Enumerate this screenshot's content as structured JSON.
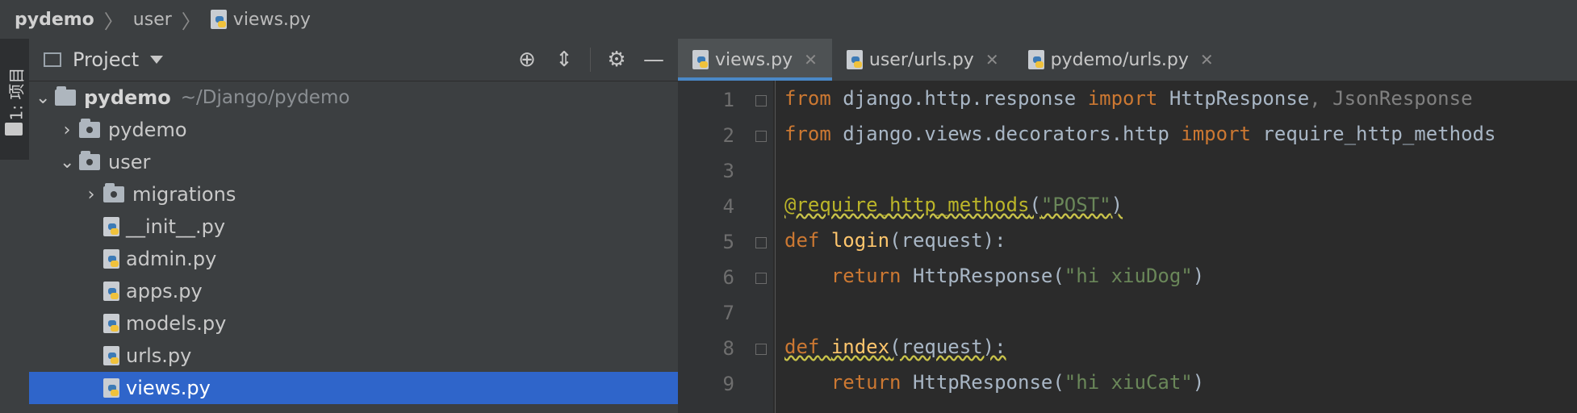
{
  "breadcrumb": {
    "items": [
      "pydemo",
      "user",
      "views.py"
    ],
    "separator": "〉"
  },
  "tool_window_strip": {
    "label": "1: 项目"
  },
  "project_panel": {
    "title": "Project",
    "root": {
      "name": "pydemo",
      "path": "~/Django/pydemo"
    },
    "tree": [
      {
        "label": "pydemo"
      },
      {
        "label": "user"
      },
      {
        "label": "migrations"
      },
      {
        "label": "__init__.py"
      },
      {
        "label": "admin.py"
      },
      {
        "label": "apps.py"
      },
      {
        "label": "models.py"
      },
      {
        "label": "urls.py"
      },
      {
        "label": "views.py",
        "selected": true
      }
    ]
  },
  "editor": {
    "tabs": [
      {
        "label": "views.py",
        "active": true
      },
      {
        "label": "user/urls.py"
      },
      {
        "label": "pydemo/urls.py"
      }
    ],
    "line_numbers": [
      "1",
      "2",
      "3",
      "4",
      "5",
      "6",
      "7",
      "8",
      "9"
    ],
    "lines": {
      "l1": {
        "a": "from",
        "b": " django.http.response ",
        "c": "import",
        "d": " HttpResponse",
        "e": ", JsonResponse"
      },
      "l2": {
        "a": "from",
        "b": " django.views.decorators.http ",
        "c": "import",
        "d": " require_http_methods"
      },
      "l4": {
        "a": "@require_http_methods",
        "b": "(",
        "c": "\"POST\"",
        "d": ")"
      },
      "l5": {
        "a": "def",
        "b": " ",
        "c": "login",
        "d": "(request):"
      },
      "l6": {
        "a": "    ",
        "b": "return",
        "c": " HttpResponse(",
        "d": "\"hi xiuDog\"",
        "e": ")"
      },
      "l8": {
        "a": "def",
        "b": " ",
        "c": "index",
        "d": "(request):"
      },
      "l9": {
        "a": "    ",
        "b": "return",
        "c": " HttpResponse(",
        "d": "\"hi xiuCat\"",
        "e": ")"
      }
    }
  },
  "colors": {
    "keyword": "#cc7832",
    "string": "#6a8759",
    "decorator": "#bbb529",
    "function": "#ffc66d",
    "selection": "#2f65ca",
    "active_tab_underline": "#4a88c7"
  },
  "icons": [
    "python-file-icon",
    "folder-icon",
    "target-icon",
    "collapse-icon",
    "gear-icon",
    "minimize-icon",
    "close-icon",
    "chevron-right-icon",
    "chevron-down-icon",
    "fold-marker-icon"
  ]
}
